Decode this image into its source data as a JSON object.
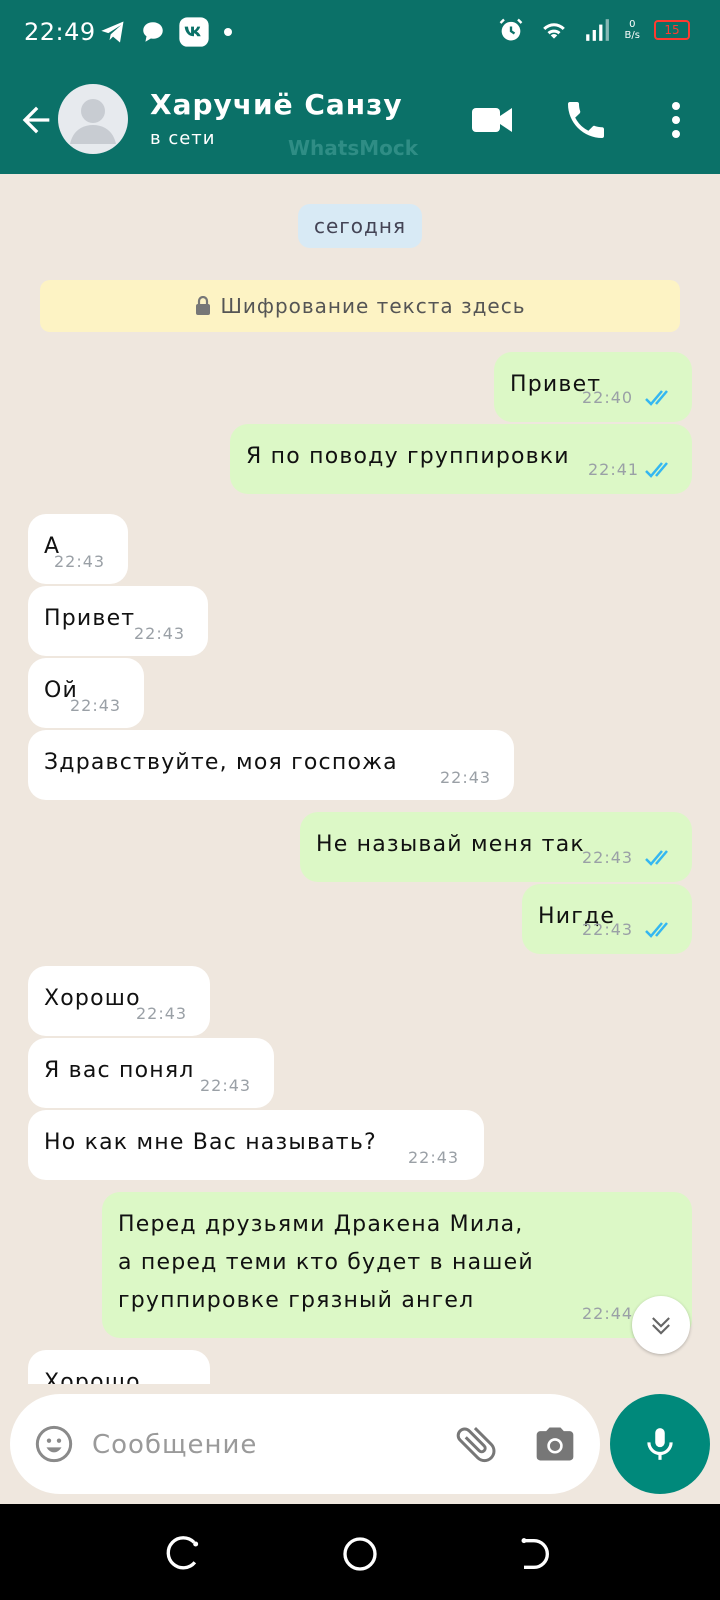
{
  "status_bar": {
    "time": "22:49",
    "net_speed_top": "0",
    "net_speed_bottom": "B/s",
    "battery": "15"
  },
  "header": {
    "contact_name": "Харучиё Санзу",
    "contact_status": "в сети",
    "watermark": "WhatsMock"
  },
  "chat": {
    "day_label": "сегодня",
    "encryption_text": "Шифрование текста здесь",
    "messages": [
      {
        "dir": "out",
        "text": "Привет",
        "time": "22:40",
        "read": true
      },
      {
        "dir": "out",
        "text": "Я по поводу группировки",
        "time": "22:41",
        "read": true
      },
      {
        "dir": "in",
        "text": "А",
        "time": "22:43"
      },
      {
        "dir": "in",
        "text": "Привет",
        "time": "22:43"
      },
      {
        "dir": "in",
        "text": "Ой",
        "time": "22:43"
      },
      {
        "dir": "in",
        "text": "Здравствуйте, моя госпожа",
        "time": "22:43"
      },
      {
        "dir": "out",
        "text": "Не называй меня так",
        "time": "22:43",
        "read": true
      },
      {
        "dir": "out",
        "text": "Нигде",
        "time": "22:43",
        "read": true
      },
      {
        "dir": "in",
        "text": "Хорошо",
        "time": "22:43"
      },
      {
        "dir": "in",
        "text": "Я вас понял",
        "time": "22:43"
      },
      {
        "dir": "in",
        "text": "Но как мне Вас называть?",
        "time": "22:43"
      },
      {
        "dir": "out",
        "text": "Перед друзьями Дракена Мила,\nа перед теми кто будет в нашей\nгруппировке грязный ангел",
        "time": "22:44",
        "read": true
      },
      {
        "dir": "in",
        "text": "Хорошо",
        "time": ""
      }
    ]
  },
  "composer": {
    "placeholder": "Сообщение"
  },
  "colors": {
    "header": "#0b7168",
    "outgoing_bubble": "#dcf8c6",
    "incoming_bubble": "#ffffff",
    "read_ticks": "#34b7f1",
    "mic_button": "#00897b"
  },
  "icons": [
    "back-arrow-icon",
    "video-call-icon",
    "phone-call-icon",
    "more-vert-icon",
    "lock-icon",
    "emoji-icon",
    "attach-icon",
    "camera-icon",
    "mic-icon",
    "scroll-down-icon"
  ]
}
